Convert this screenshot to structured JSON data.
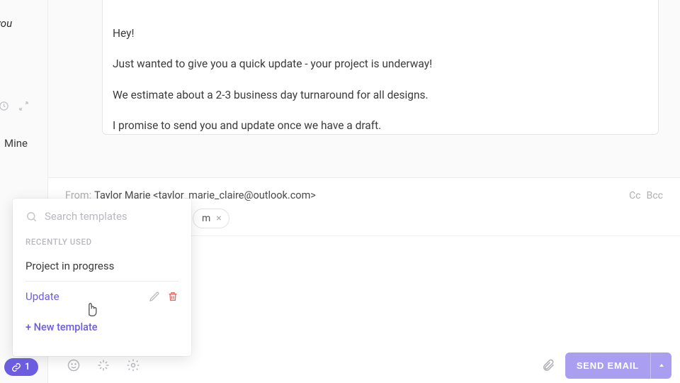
{
  "left": {
    "italic_text": "you",
    "mine_tab": "Mine"
  },
  "message": {
    "p1": "Hey!",
    "p2": "Just wanted to give you a quick update - your project is underway!",
    "p3": "We estimate about a 2-3 business day turnaround for all designs.",
    "p4": "I promise to send you and update once we have a draft."
  },
  "compose": {
    "from_label": "From:",
    "from_value": "Taylor Marie <taylor_marie_claire@outlook.com>",
    "cc": "Cc",
    "bcc": "Bcc",
    "chip_text": "m",
    "chip_close": "×"
  },
  "templates": {
    "search_placeholder": "Search templates",
    "section_label": "RECENTLY USED",
    "items": [
      {
        "name": "Project in progress"
      },
      {
        "name": "Update"
      }
    ],
    "new_template": "+ New template"
  },
  "bottom": {
    "send_label": "SEND EMAIL",
    "link_count": "1"
  },
  "colors": {
    "accent": "#6b5ce0",
    "send_bg": "#a99eef",
    "danger": "#e06a62"
  }
}
